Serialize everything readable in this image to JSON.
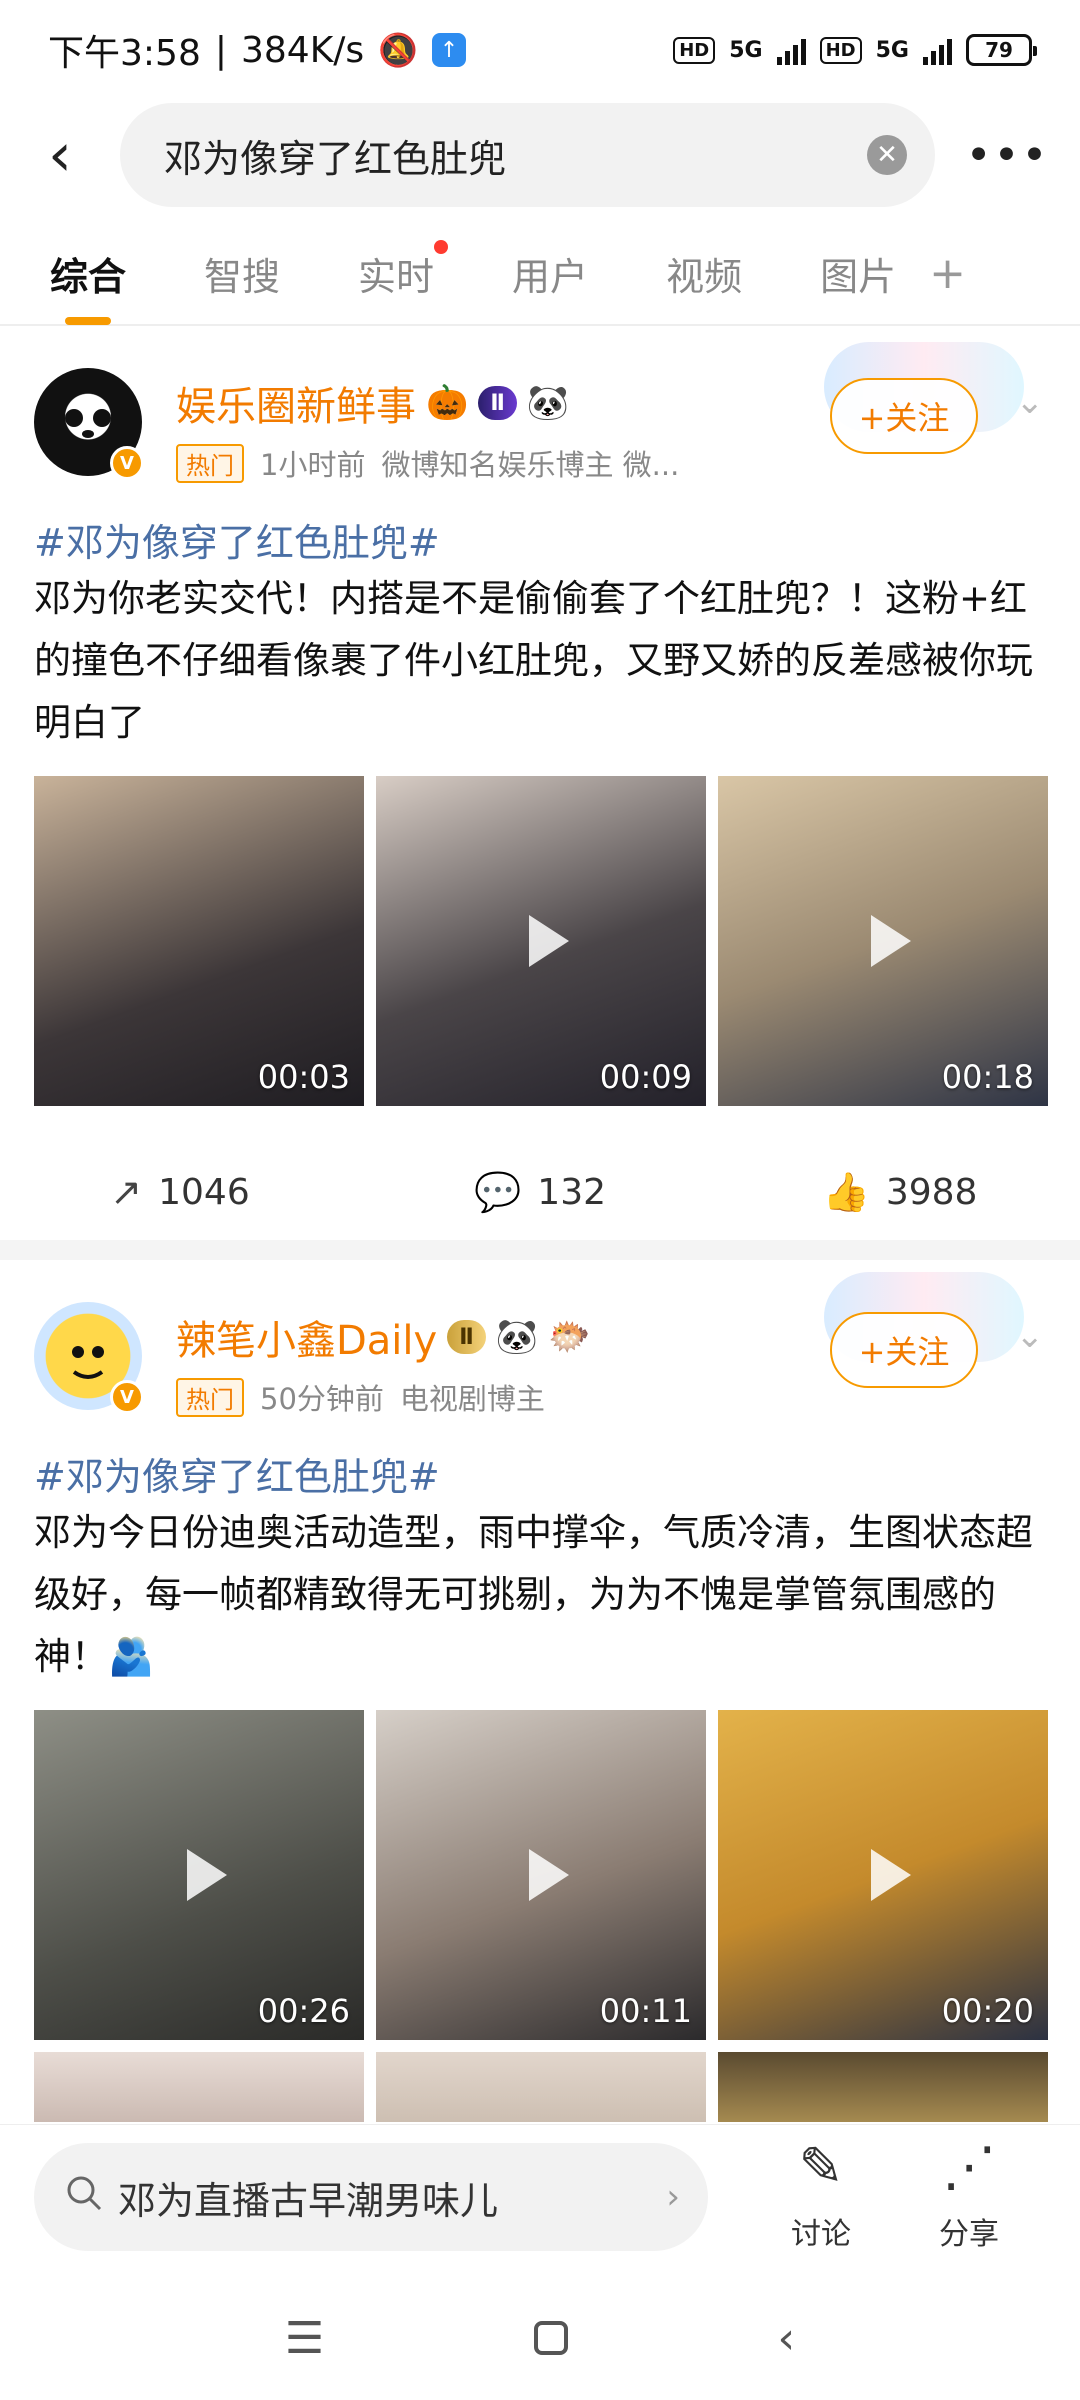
{
  "status_bar": {
    "time": "下午3:58",
    "net_speed": "384K/s",
    "hd1": "HD",
    "g1": "5G",
    "hd2": "HD",
    "g2": "5G",
    "battery": "79"
  },
  "header": {
    "query": "邓为像穿了红色肚兜",
    "back_icon": "chevron-left-icon",
    "more_icon": "more-icon"
  },
  "tabs": [
    "综合",
    "智搜",
    "实时",
    "用户",
    "视频",
    "图片"
  ],
  "tab_plus": "+",
  "posts": [
    {
      "username": "娱乐圈新鲜事",
      "badge": "Ⅱ",
      "hot_tag": "热门",
      "time": "1小时前",
      "desc": "微博知名娱乐博主 微...",
      "follow": "+关注",
      "topic": "#邓为像穿了红色肚兜#",
      "content": "邓为你老实交代！内搭是不是偷偷套了个红肚兜？！这粉+红的撞色不仔细看像裹了件小红肚兜，又野又娇的反差感被你玩明白了",
      "videos": [
        {
          "duration": "00:03",
          "color": "#6a5a50"
        },
        {
          "duration": "00:09",
          "color": "#5a5450"
        },
        {
          "duration": "00:18",
          "color": "#b59a7a"
        }
      ],
      "reposts": "1046",
      "comments": "132",
      "likes": "3988"
    },
    {
      "username": "辣笔小鑫Daily",
      "badge": "Ⅱ",
      "hot_tag": "热门",
      "time": "50分钟前",
      "desc": "电视剧博主",
      "follow": "+关注",
      "topic": "#邓为像穿了红色肚兜#",
      "content": "邓为今日份迪奥活动造型，雨中撑伞，气质冷清，生图状态超级好，每一帧都精致得无可挑剔，为为不愧是掌管氛围感的神！🫂",
      "videos": [
        {
          "duration": "00:26",
          "color": "#6e7068"
        },
        {
          "duration": "00:11",
          "color": "#8a8078"
        },
        {
          "duration": "00:20",
          "color": "#c99a40"
        }
      ]
    }
  ],
  "bottom": {
    "search_text": "邓为直播古早潮男味儿",
    "discuss": "讨论",
    "share": "分享"
  }
}
